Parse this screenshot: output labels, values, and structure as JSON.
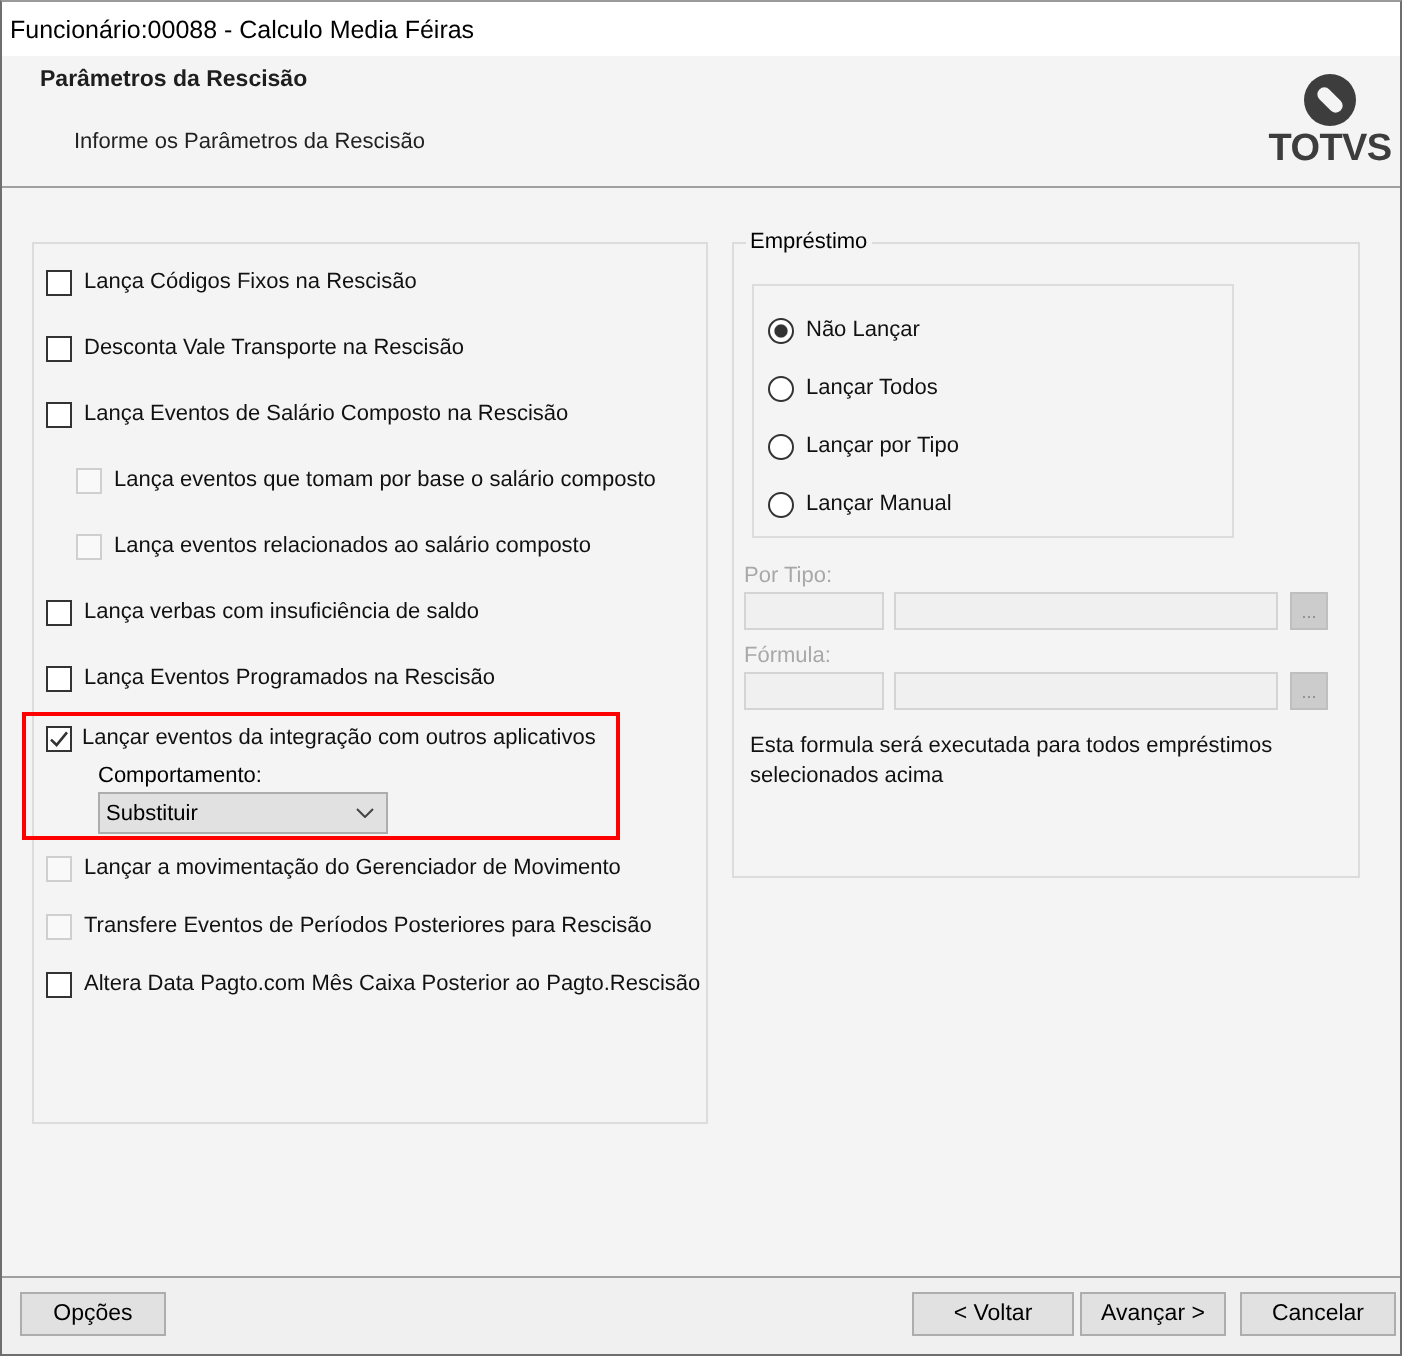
{
  "window": {
    "title": "Funcionário:00088 - Calculo Media Féiras"
  },
  "header": {
    "title": "Parâmetros da Rescisão",
    "subtitle": "Informe os Parâmetros da Rescisão",
    "logo_text": "TOTVS"
  },
  "options": [
    {
      "label": "Lança Códigos Fixos na Rescisão",
      "checked": false,
      "disabled": false
    },
    {
      "label": "Desconta Vale Transporte na Rescisão",
      "checked": false,
      "disabled": false
    },
    {
      "label": "Lança Eventos de Salário Composto na Rescisão",
      "checked": false,
      "disabled": false,
      "children": [
        {
          "label": "Lança eventos que tomam por base o salário composto",
          "checked": false,
          "disabled": true
        },
        {
          "label": "Lança eventos relacionados ao salário composto",
          "checked": false,
          "disabled": true
        }
      ]
    },
    {
      "label": "Lança verbas com insuficiência de saldo",
      "checked": false,
      "disabled": false
    },
    {
      "label": "Lança Eventos Programados na Rescisão",
      "checked": false,
      "disabled": false
    },
    {
      "label": "Lançar eventos da integração com outros aplicativos",
      "checked": true,
      "disabled": false,
      "highlighted": true,
      "behavior": {
        "label": "Comportamento:",
        "value": "Substituir"
      }
    },
    {
      "label": "Lançar a movimentação do Gerenciador de Movimento",
      "checked": false,
      "disabled": true
    },
    {
      "label": "Transfere Eventos de Períodos Posteriores para Rescisão",
      "checked": false,
      "disabled": true
    },
    {
      "label": "Altera Data Pagto.com Mês Caixa Posterior ao Pagto.Rescisão",
      "checked": false,
      "disabled": false
    }
  ],
  "loan": {
    "title": "Empréstimo",
    "radios": [
      {
        "label": "Não Lançar",
        "selected": true
      },
      {
        "label": "Lançar Todos",
        "selected": false
      },
      {
        "label": "Lançar por Tipo",
        "selected": false
      },
      {
        "label": "Lançar Manual",
        "selected": false
      }
    ],
    "lookups": [
      {
        "label": "Por Tipo:",
        "disabled": true,
        "button": "..."
      },
      {
        "label": "Fórmula:",
        "disabled": true,
        "button": "..."
      }
    ],
    "note": "Esta formula será executada para todos empréstimos selecionados acima"
  },
  "footer": {
    "left_buttons": [
      "Opções"
    ],
    "nav_buttons": [
      "< Voltar",
      "Avançar >"
    ],
    "cancel_button": "Cancelar"
  }
}
